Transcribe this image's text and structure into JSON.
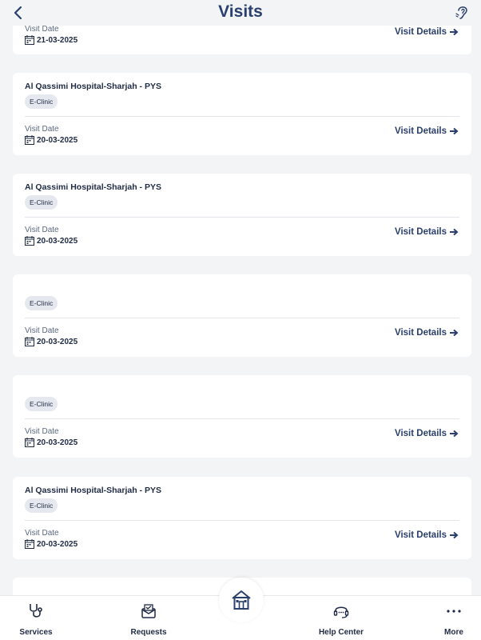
{
  "header": {
    "title": "Visits"
  },
  "visits": [
    {
      "hospital": "",
      "type": "",
      "date_label": "Visit Date",
      "date": "21-03-2025",
      "details_label": "Visit Details"
    },
    {
      "hospital": "Al Qassimi Hospital-Sharjah - PYS",
      "type": "E-Clinic",
      "date_label": "Visit Date",
      "date": "20-03-2025",
      "details_label": "Visit Details"
    },
    {
      "hospital": "Al Qassimi Hospital-Sharjah - PYS",
      "type": "E-Clinic",
      "date_label": "Visit Date",
      "date": "20-03-2025",
      "details_label": "Visit Details"
    },
    {
      "hospital": "",
      "type": "E-Clinic",
      "date_label": "Visit Date",
      "date": "20-03-2025",
      "details_label": "Visit Details"
    },
    {
      "hospital": "",
      "type": "E-Clinic",
      "date_label": "Visit Date",
      "date": "20-03-2025",
      "details_label": "Visit Details"
    },
    {
      "hospital": "Al Qassimi Hospital-Sharjah - PYS",
      "type": "E-Clinic",
      "date_label": "Visit Date",
      "date": "20-03-2025",
      "details_label": "Visit Details"
    }
  ],
  "tabbar": {
    "services": "Services",
    "requests": "Requests",
    "help_center": "Help Center",
    "more": "More"
  },
  "icons": {
    "back": "chevron-left-icon",
    "accessibility": "hearing-icon",
    "calendar": "calendar-icon",
    "arrow": "arrow-right-icon",
    "home": "home-icon"
  },
  "colors": {
    "primary": "#2a3f6d",
    "background": "#f3f4f6",
    "badge": "#e5e8ee"
  }
}
